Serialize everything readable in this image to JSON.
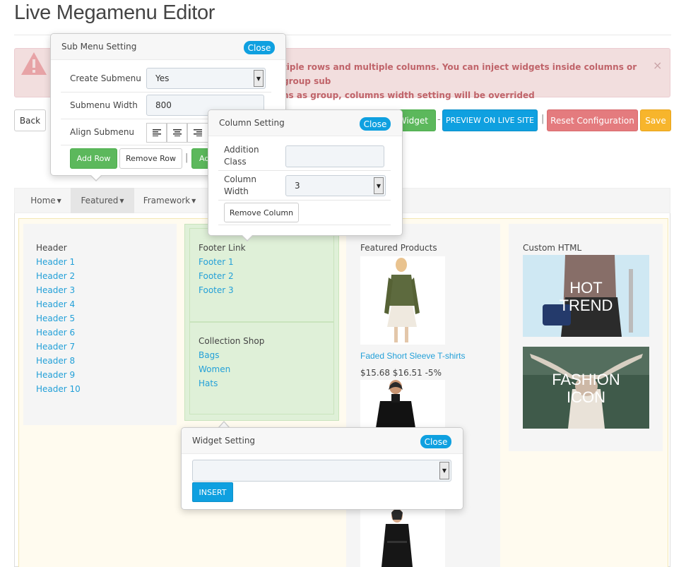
{
  "page": {
    "title": "Live Megamenu Editor"
  },
  "alert": {
    "text_line1": "tiple rows and multiple columns. You can inject widgets inside columns or group sub",
    "text_line2": "ns as group, columns width setting will be overrided",
    "close": "×",
    "icon": "warning-icon"
  },
  "toolbar": {
    "back": "Back",
    "widget": "Widget",
    "dash": "-",
    "preview": "PREVIEW ON LIVE SITE",
    "pipe": "|",
    "reset": "Reset Configuration",
    "save": "Save"
  },
  "submenu_setting": {
    "title": "Sub Menu Setting",
    "close": "Close",
    "create_label": "Create Submenu",
    "create_value": "Yes",
    "width_label": "Submenu Width",
    "width_value": "800",
    "align_label": "Align Submenu",
    "add_row": "Add Row",
    "remove_row": "Remove Row",
    "pipe": "|",
    "add_col_partial": "Ad"
  },
  "column_setting": {
    "title": "Column Setting",
    "close": "Close",
    "class_label_1": "Addition",
    "class_label_2": "Class",
    "class_value": "",
    "width_label_1": "Column",
    "width_label_2": "Width",
    "width_value": "3",
    "remove_column": "Remove Column"
  },
  "widget_setting": {
    "title": "Widget Setting",
    "close": "Close",
    "select_value": "",
    "insert": "INSERT"
  },
  "nav": {
    "items": [
      {
        "label": "Home"
      },
      {
        "label": "Featured"
      },
      {
        "label": "Framework"
      }
    ]
  },
  "columns": {
    "header": {
      "title": "Header",
      "links": [
        "Header 1",
        "Header 2",
        "Header 3",
        "Header 4",
        "Header 5",
        "Header 6",
        "Header 7",
        "Header 8",
        "Header 9",
        "Header 10"
      ]
    },
    "footer": {
      "title": "Footer Link",
      "links": [
        "Footer 1",
        "Footer 2",
        "Footer 3"
      ]
    },
    "collection": {
      "title": "Collection Shop",
      "links": [
        "Bags",
        "Women",
        "Hats"
      ]
    },
    "featured": {
      "title": "Featured Products",
      "product_name": "Faded Short Sleeve T-shirts",
      "product_price": "$15.68 $16.51 -5%"
    },
    "custom": {
      "title": "Custom HTML",
      "banner1_line1": "HOT",
      "banner1_line2": "TREND",
      "banner2_line1": "FASHION",
      "banner2_line2": "ICON"
    }
  }
}
